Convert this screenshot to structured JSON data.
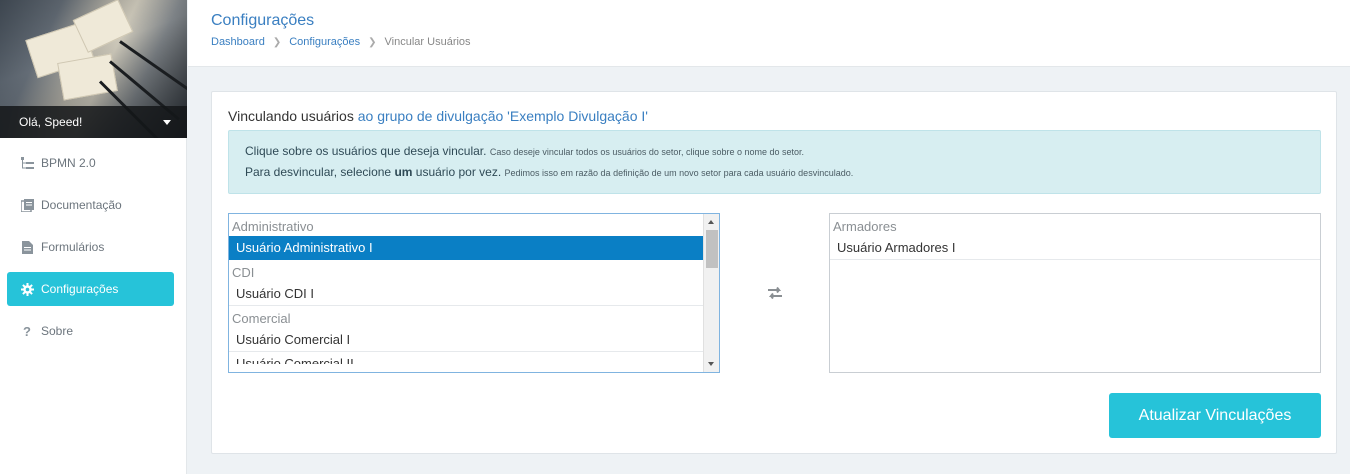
{
  "sidebar": {
    "greeting": "Olá, Speed!",
    "items": [
      {
        "label": "BPMN 2.0",
        "icon": "sitemap-icon"
      },
      {
        "label": "Documentação",
        "icon": "book-icon"
      },
      {
        "label": "Formulários",
        "icon": "file-icon"
      },
      {
        "label": "Configurações",
        "icon": "gear-icon",
        "active": true
      },
      {
        "label": "Sobre",
        "icon": "question-icon"
      }
    ]
  },
  "header": {
    "title": "Configurações",
    "breadcrumb": [
      "Dashboard",
      "Configurações",
      "Vincular Usuários"
    ]
  },
  "card": {
    "heading_prefix": "Vinculando usuários",
    "heading_highlight": "ao grupo de divulgação 'Exemplo Divulgação I'",
    "alert": {
      "line1_main": "Clique sobre os usuários que deseja vincular.",
      "line1_small": "Caso deseje vincular todos os usuários do setor, clique sobre o nome do setor.",
      "line2_pre": "Para desvincular, selecione",
      "line2_bold": "um",
      "line2_post": "usuário por vez.",
      "line2_small": "Pedimos isso em razão da definição de um novo setor para cada usuário desvinculado."
    },
    "available": {
      "groups": [
        {
          "label": "Administrativo",
          "options": [
            "Usuário Administrativo I"
          ],
          "selected": 0
        },
        {
          "label": "CDI",
          "options": [
            "Usuário CDI I"
          ]
        },
        {
          "label": "Comercial",
          "options": [
            "Usuário Comercial I",
            "Usuário Comercial II"
          ]
        }
      ]
    },
    "linked": {
      "groups": [
        {
          "label": "Armadores",
          "options": [
            "Usuário Armadores I"
          ]
        }
      ]
    },
    "submit_label": "Atualizar Vinculações"
  },
  "colors": {
    "accent": "#26c3d9",
    "link": "#3a7fc1",
    "selected": "#0a7fc5",
    "alert_bg": "#d7eef1"
  }
}
